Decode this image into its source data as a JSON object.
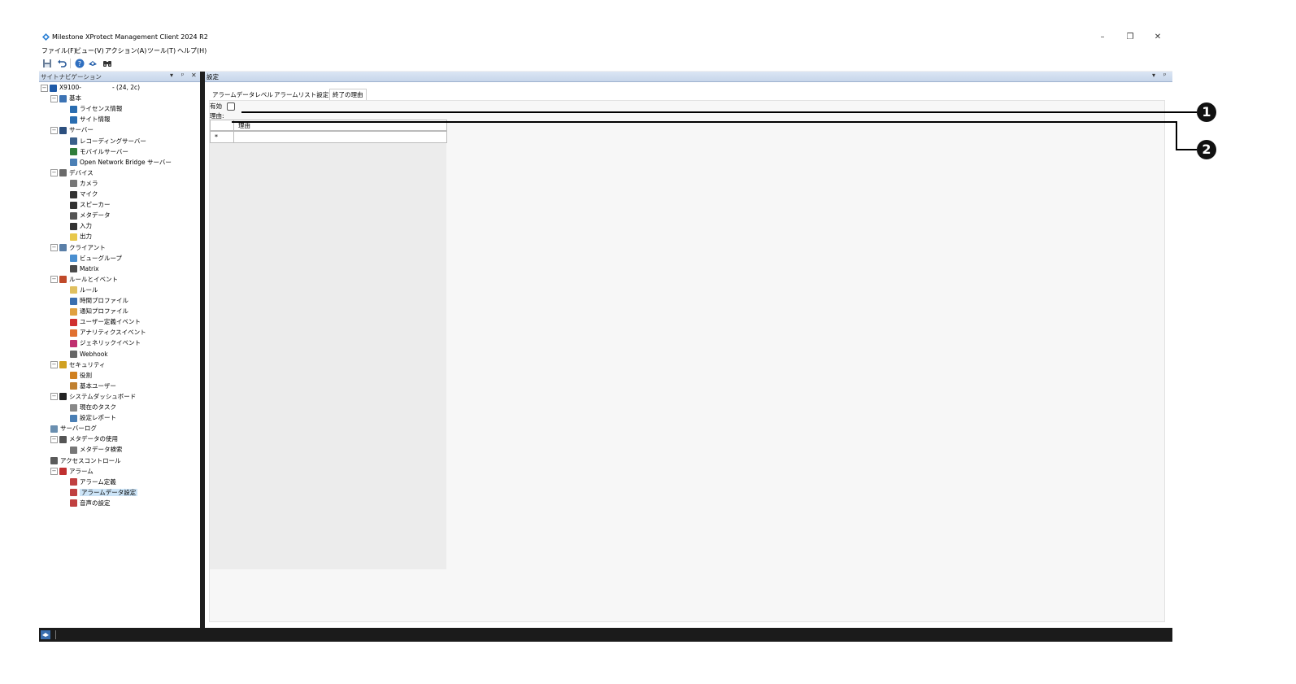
{
  "window": {
    "title": "Milestone XProtect Management Client 2024 R2",
    "controls": {
      "minimize": "–",
      "restore": "❐",
      "close": "✕"
    }
  },
  "menu": [
    "ファイル(F)",
    "ビュー(V)",
    "アクション(A)",
    "ツール(T)",
    "ヘルプ(H)"
  ],
  "toolbar": {
    "icons": [
      "save-icon",
      "undo-icon",
      "help-icon",
      "connect-icon",
      "find-icon"
    ]
  },
  "site_nav": {
    "header": "サイトナビゲーション",
    "controls": {
      "dropdown": "▾",
      "pin": "ᵖ",
      "close": "✕"
    },
    "server_suffix": "- (24, 2c)",
    "tree": [
      {
        "label": "X9100-",
        "level": 0,
        "exp": "⊟",
        "color": "#1e5aa8"
      },
      {
        "label": "基本",
        "level": 1,
        "exp": "⊟",
        "color": "#3c73b4"
      },
      {
        "label": "ライセンス情報",
        "level": 2,
        "color": "#2a6db0"
      },
      {
        "label": "サイト情報",
        "level": 2,
        "color": "#2a6db0"
      },
      {
        "label": "サーバー",
        "level": 1,
        "exp": "⊟",
        "color": "#2c4f7e"
      },
      {
        "label": "レコーディングサーバー",
        "level": 2,
        "color": "#3a5f8a"
      },
      {
        "label": "モバイルサーバー",
        "level": 2,
        "color": "#2f7d3a"
      },
      {
        "label": "Open Network Bridge サーバー",
        "level": 2,
        "color": "#4a7fb5"
      },
      {
        "label": "デバイス",
        "level": 1,
        "exp": "⊟",
        "color": "#6a6a6a"
      },
      {
        "label": "カメラ",
        "level": 2,
        "color": "#777777"
      },
      {
        "label": "マイク",
        "level": 2,
        "color": "#333333"
      },
      {
        "label": "スピーカー",
        "level": 2,
        "color": "#333333"
      },
      {
        "label": "メタデータ",
        "level": 2,
        "color": "#555555"
      },
      {
        "label": "入力",
        "level": 2,
        "color": "#333333"
      },
      {
        "label": "出力",
        "level": 2,
        "color": "#e8c84a"
      },
      {
        "label": "クライアント",
        "level": 1,
        "exp": "⊟",
        "color": "#5a7fa8"
      },
      {
        "label": "ビューグループ",
        "level": 2,
        "color": "#4a8fd0"
      },
      {
        "label": "Matrix",
        "level": 2,
        "color": "#4a4a4a"
      },
      {
        "label": "ルールとイベント",
        "level": 1,
        "exp": "⊟",
        "color": "#c04a2a"
      },
      {
        "label": "ルール",
        "level": 2,
        "color": "#e0c060"
      },
      {
        "label": "時間プロファイル",
        "level": 2,
        "color": "#3a6fb0"
      },
      {
        "label": "通知プロファイル",
        "level": 2,
        "color": "#e0a040"
      },
      {
        "label": "ユーザー定義イベント",
        "level": 2,
        "color": "#d03030"
      },
      {
        "label": "アナリティクスイベント",
        "level": 2,
        "color": "#e07030"
      },
      {
        "label": "ジェネリックイベント",
        "level": 2,
        "color": "#c03070"
      },
      {
        "label": "Webhook",
        "level": 2,
        "color": "#666666"
      },
      {
        "label": "セキュリティ",
        "level": 1,
        "exp": "⊟",
        "color": "#d0a020"
      },
      {
        "label": "役割",
        "level": 2,
        "color": "#d08020"
      },
      {
        "label": "基本ユーザー",
        "level": 2,
        "color": "#c08030"
      },
      {
        "label": "システムダッシュボード",
        "level": 1,
        "exp": "⊟",
        "color": "#222222"
      },
      {
        "label": "現在のタスク",
        "level": 2,
        "color": "#888888"
      },
      {
        "label": "設定レポート",
        "level": 2,
        "color": "#4a7fb5"
      },
      {
        "label": "サーバーログ",
        "level": 1,
        "color": "#6a8fb0"
      },
      {
        "label": "メタデータの使用",
        "level": 1,
        "exp": "⊟",
        "color": "#555555"
      },
      {
        "label": "メタデータ検索",
        "level": 2,
        "color": "#777777"
      },
      {
        "label": "アクセスコントロール",
        "level": 1,
        "color": "#5a5a5a"
      },
      {
        "label": "アラーム",
        "level": 1,
        "exp": "⊟",
        "color": "#c03030"
      },
      {
        "label": "アラーム定義",
        "level": 2,
        "color": "#c04040"
      },
      {
        "label": "アラームデータ設定",
        "level": 2,
        "color": "#c04040",
        "selected": true
      },
      {
        "label": "音声の設定",
        "level": 2,
        "color": "#c04040"
      }
    ]
  },
  "settings": {
    "header": "設定",
    "controls": {
      "dropdown": "▾",
      "pin": "ᵖ"
    },
    "tabs": [
      "アラームデータレベル",
      "アラームリスト設定",
      "終了の理由"
    ],
    "active_tab": 2,
    "enabled_label": "有効",
    "enabled_checked": false,
    "reason_label": "理由:",
    "grid": {
      "column_header": "理由",
      "new_row_marker": "*"
    }
  },
  "callouts": [
    "1",
    "2"
  ]
}
